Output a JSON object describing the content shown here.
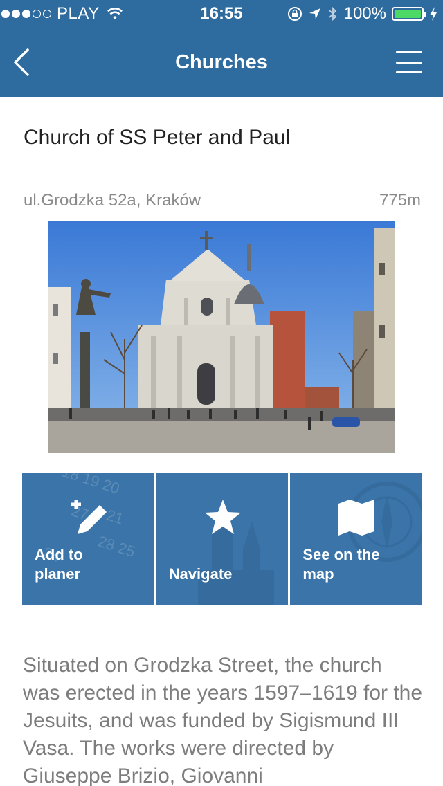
{
  "status_bar": {
    "carrier": "PLAY",
    "time": "16:55",
    "battery": "100%",
    "battery_level": 1.0,
    "signal_bars_filled": 3,
    "signal_bars_total": 5,
    "icons": [
      "wifi-icon",
      "rotation-lock-icon",
      "location-arrow-icon",
      "bluetooth-icon",
      "charging-bolt-icon"
    ]
  },
  "nav": {
    "title": "Churches",
    "back_icon": "chevron-left-icon",
    "menu_icon": "hamburger-menu-icon"
  },
  "place": {
    "title": "Church of SS Peter and Paul",
    "address": "ul.Grodzka 52a, Kraków",
    "distance": "775m",
    "photo_subject": "church-photo"
  },
  "actions": [
    {
      "label": "Add to\nplaner",
      "icon": "pencil-plus-icon",
      "background": "calendar-pattern"
    },
    {
      "label": "Navigate",
      "icon": "star-icon",
      "background": "church-tower-pattern"
    },
    {
      "label": "See on the\nmap",
      "icon": "folded-map-icon",
      "background": "compass-pattern"
    }
  ],
  "description": "Situated on Grodzka Street, the church was erected in the years 1597–1619 for the Jesuits, and was funded by Sigismund III Vasa. The works were directed by Giuseppe Brizio, Giovanni",
  "colors": {
    "header": "#2e6b9f",
    "action_tile": "#3a74a8",
    "battery_fill": "#4cd964",
    "description_text": "#7d7d7d"
  }
}
